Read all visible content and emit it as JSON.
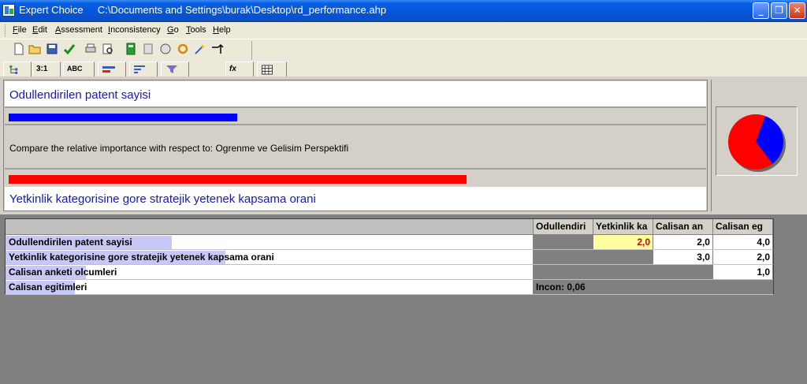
{
  "window": {
    "title": "Expert Choice     C:\\Documents and Settings\\burak\\Desktop\\rd_performance.ahp"
  },
  "menu": [
    {
      "label": "File",
      "ul": "F"
    },
    {
      "label": "Edit",
      "ul": "E"
    },
    {
      "label": "Assessment",
      "ul": "A"
    },
    {
      "label": "Inconsistency",
      "ul": "I"
    },
    {
      "label": "Go",
      "ul": "G"
    },
    {
      "label": "Tools",
      "ul": "T"
    },
    {
      "label": "Help",
      "ul": "H"
    }
  ],
  "tabs": [
    {
      "label": "3:1"
    },
    {
      "label": "ABC"
    },
    {
      "label": "fx"
    }
  ],
  "comparison": {
    "item_a": "Odullendirilen patent sayisi",
    "item_b": "Yetkinlik kategorisine gore stratejik yetenek kapsama orani",
    "question": "Compare the relative importance with respect to: Ogrenme ve Gelisim Perspektifi",
    "bar_a_fraction": 0.33,
    "bar_b_fraction": 0.66,
    "bar_a_color": "#0000ff",
    "bar_b_color": "#ff0000"
  },
  "pie": {
    "blue_fraction": 0.34,
    "blue_color": "#0000ff",
    "red_color": "#ff0000"
  },
  "matrix": {
    "columns": [
      "Odullendiri",
      "Yetkinlik ka",
      "Calisan an",
      "Calisan eg"
    ],
    "rows": [
      {
        "label": "Odullendirilen patent sayisi",
        "weight": 0.31,
        "cells": [
          "",
          "2,0",
          "2,0",
          "4,0"
        ]
      },
      {
        "label": "Yetkinlik kategorisine gore stratejik yetenek kapsama orani",
        "weight": 0.41,
        "cells": [
          "",
          "",
          "3,0",
          "2,0"
        ]
      },
      {
        "label": "Calisan anketi olcumleri",
        "weight": 0.15,
        "cells": [
          "",
          "",
          "",
          "1,0"
        ]
      },
      {
        "label": "Calisan egitimleri",
        "weight": 0.13,
        "cells": [
          "Incon: 0,06",
          "",
          "",
          ""
        ]
      }
    ]
  }
}
